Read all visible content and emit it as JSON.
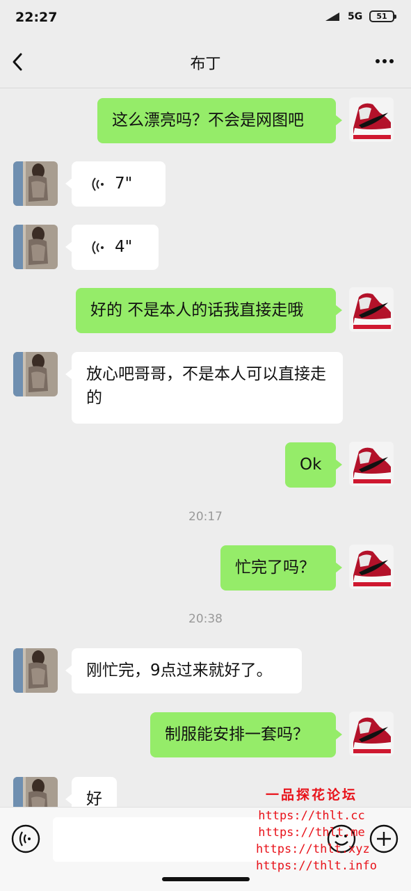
{
  "status_bar": {
    "time": "22:27",
    "network": "5G",
    "battery": "51"
  },
  "header": {
    "title": "布丁"
  },
  "messages": [
    {
      "side": "out",
      "type": "text",
      "text": "这么漂亮吗？不会是网图吧"
    },
    {
      "side": "in",
      "type": "voice",
      "text": "7\""
    },
    {
      "side": "in",
      "type": "voice",
      "text": "4\""
    },
    {
      "side": "out",
      "type": "text",
      "text": "好的 不是本人的话我直接走哦"
    },
    {
      "side": "in",
      "type": "text",
      "text": "放心吧哥哥，不是本人可以直接走的"
    },
    {
      "side": "out",
      "type": "text",
      "text": "Ok"
    },
    {
      "type": "timestamp",
      "text": "20:17"
    },
    {
      "side": "out",
      "type": "text",
      "text": "忙完了吗？"
    },
    {
      "type": "timestamp",
      "text": "20:38"
    },
    {
      "side": "in",
      "type": "text",
      "text": "刚忙完，9点过来就好了。"
    },
    {
      "side": "out",
      "type": "text",
      "text": "制服能安排一套吗？"
    },
    {
      "side": "in",
      "type": "text",
      "text": "好"
    }
  ],
  "input_bar": {
    "placeholder": ""
  },
  "watermark": {
    "title": "一品探花论坛",
    "lines": [
      "https://thlt.cc",
      "https://thlt.me",
      "https://thlt.xyz",
      "https://thlt.info"
    ]
  },
  "colors": {
    "bubble_out": "#95ec69",
    "bubble_in": "#ffffff",
    "background": "#ededed",
    "watermark": "#e8121a"
  }
}
